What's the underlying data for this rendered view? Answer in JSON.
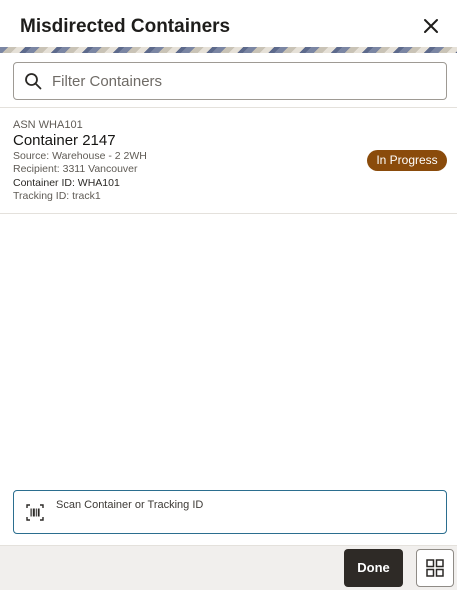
{
  "header": {
    "title": "Misdirected Containers",
    "close_icon": "close-icon"
  },
  "filter": {
    "placeholder": "Filter Containers",
    "value": "",
    "icon": "search-icon"
  },
  "items": [
    {
      "asn": "ASN WHA101",
      "name": "Container 2147",
      "source": "Source: Warehouse - 2 2WH",
      "recipient": "Recipient: 3311 Vancouver",
      "container_id": "Container ID: WHA101",
      "tracking_id": "Tracking ID: track1",
      "status": "In Progress"
    }
  ],
  "scan": {
    "label": "Scan Container or Tracking ID",
    "icon": "barcode-icon"
  },
  "footer": {
    "done_label": "Done",
    "grid_icon": "grid-icon"
  },
  "colors": {
    "status_badge": "#8a4b0b",
    "done_button": "#2e2a26",
    "scan_border": "#2b6e8f",
    "footer_bg": "#f1efed"
  }
}
